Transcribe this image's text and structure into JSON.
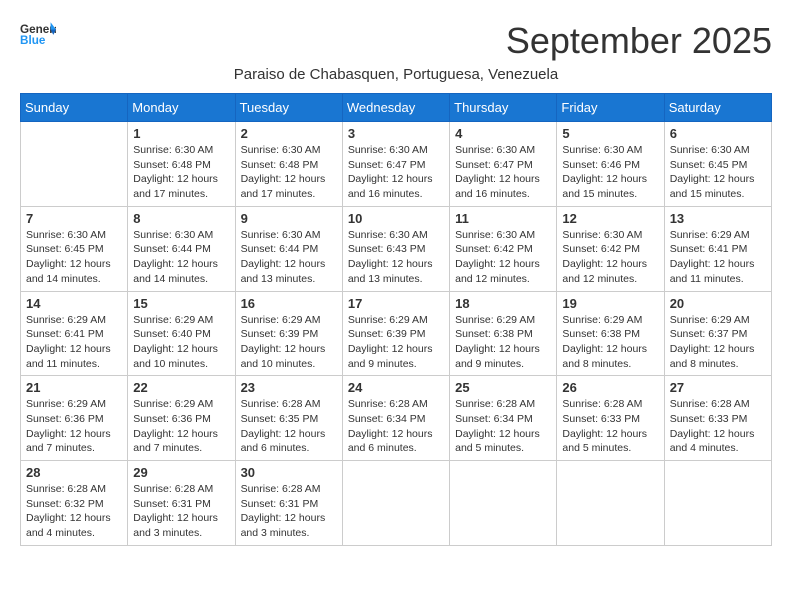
{
  "logo": {
    "line1": "General",
    "line2": "Blue"
  },
  "title": "September 2025",
  "subtitle": "Paraiso de Chabasquen, Portuguesa, Venezuela",
  "weekdays": [
    "Sunday",
    "Monday",
    "Tuesday",
    "Wednesday",
    "Thursday",
    "Friday",
    "Saturday"
  ],
  "weeks": [
    [
      {
        "day": "",
        "info": ""
      },
      {
        "day": "1",
        "info": "Sunrise: 6:30 AM\nSunset: 6:48 PM\nDaylight: 12 hours\nand 17 minutes."
      },
      {
        "day": "2",
        "info": "Sunrise: 6:30 AM\nSunset: 6:48 PM\nDaylight: 12 hours\nand 17 minutes."
      },
      {
        "day": "3",
        "info": "Sunrise: 6:30 AM\nSunset: 6:47 PM\nDaylight: 12 hours\nand 16 minutes."
      },
      {
        "day": "4",
        "info": "Sunrise: 6:30 AM\nSunset: 6:47 PM\nDaylight: 12 hours\nand 16 minutes."
      },
      {
        "day": "5",
        "info": "Sunrise: 6:30 AM\nSunset: 6:46 PM\nDaylight: 12 hours\nand 15 minutes."
      },
      {
        "day": "6",
        "info": "Sunrise: 6:30 AM\nSunset: 6:45 PM\nDaylight: 12 hours\nand 15 minutes."
      }
    ],
    [
      {
        "day": "7",
        "info": "Sunrise: 6:30 AM\nSunset: 6:45 PM\nDaylight: 12 hours\nand 14 minutes."
      },
      {
        "day": "8",
        "info": "Sunrise: 6:30 AM\nSunset: 6:44 PM\nDaylight: 12 hours\nand 14 minutes."
      },
      {
        "day": "9",
        "info": "Sunrise: 6:30 AM\nSunset: 6:44 PM\nDaylight: 12 hours\nand 13 minutes."
      },
      {
        "day": "10",
        "info": "Sunrise: 6:30 AM\nSunset: 6:43 PM\nDaylight: 12 hours\nand 13 minutes."
      },
      {
        "day": "11",
        "info": "Sunrise: 6:30 AM\nSunset: 6:42 PM\nDaylight: 12 hours\nand 12 minutes."
      },
      {
        "day": "12",
        "info": "Sunrise: 6:30 AM\nSunset: 6:42 PM\nDaylight: 12 hours\nand 12 minutes."
      },
      {
        "day": "13",
        "info": "Sunrise: 6:29 AM\nSunset: 6:41 PM\nDaylight: 12 hours\nand 11 minutes."
      }
    ],
    [
      {
        "day": "14",
        "info": "Sunrise: 6:29 AM\nSunset: 6:41 PM\nDaylight: 12 hours\nand 11 minutes."
      },
      {
        "day": "15",
        "info": "Sunrise: 6:29 AM\nSunset: 6:40 PM\nDaylight: 12 hours\nand 10 minutes."
      },
      {
        "day": "16",
        "info": "Sunrise: 6:29 AM\nSunset: 6:39 PM\nDaylight: 12 hours\nand 10 minutes."
      },
      {
        "day": "17",
        "info": "Sunrise: 6:29 AM\nSunset: 6:39 PM\nDaylight: 12 hours\nand 9 minutes."
      },
      {
        "day": "18",
        "info": "Sunrise: 6:29 AM\nSunset: 6:38 PM\nDaylight: 12 hours\nand 9 minutes."
      },
      {
        "day": "19",
        "info": "Sunrise: 6:29 AM\nSunset: 6:38 PM\nDaylight: 12 hours\nand 8 minutes."
      },
      {
        "day": "20",
        "info": "Sunrise: 6:29 AM\nSunset: 6:37 PM\nDaylight: 12 hours\nand 8 minutes."
      }
    ],
    [
      {
        "day": "21",
        "info": "Sunrise: 6:29 AM\nSunset: 6:36 PM\nDaylight: 12 hours\nand 7 minutes."
      },
      {
        "day": "22",
        "info": "Sunrise: 6:29 AM\nSunset: 6:36 PM\nDaylight: 12 hours\nand 7 minutes."
      },
      {
        "day": "23",
        "info": "Sunrise: 6:28 AM\nSunset: 6:35 PM\nDaylight: 12 hours\nand 6 minutes."
      },
      {
        "day": "24",
        "info": "Sunrise: 6:28 AM\nSunset: 6:34 PM\nDaylight: 12 hours\nand 6 minutes."
      },
      {
        "day": "25",
        "info": "Sunrise: 6:28 AM\nSunset: 6:34 PM\nDaylight: 12 hours\nand 5 minutes."
      },
      {
        "day": "26",
        "info": "Sunrise: 6:28 AM\nSunset: 6:33 PM\nDaylight: 12 hours\nand 5 minutes."
      },
      {
        "day": "27",
        "info": "Sunrise: 6:28 AM\nSunset: 6:33 PM\nDaylight: 12 hours\nand 4 minutes."
      }
    ],
    [
      {
        "day": "28",
        "info": "Sunrise: 6:28 AM\nSunset: 6:32 PM\nDaylight: 12 hours\nand 4 minutes."
      },
      {
        "day": "29",
        "info": "Sunrise: 6:28 AM\nSunset: 6:31 PM\nDaylight: 12 hours\nand 3 minutes."
      },
      {
        "day": "30",
        "info": "Sunrise: 6:28 AM\nSunset: 6:31 PM\nDaylight: 12 hours\nand 3 minutes."
      },
      {
        "day": "",
        "info": ""
      },
      {
        "day": "",
        "info": ""
      },
      {
        "day": "",
        "info": ""
      },
      {
        "day": "",
        "info": ""
      }
    ]
  ]
}
